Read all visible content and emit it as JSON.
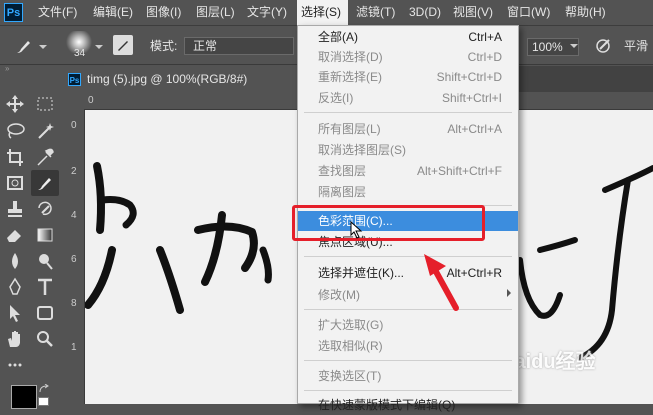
{
  "app": {
    "logo": "Ps"
  },
  "menubar": [
    {
      "label": "文件(F)",
      "active": false
    },
    {
      "label": "编辑(E)",
      "active": false
    },
    {
      "label": "图像(I)",
      "active": false
    },
    {
      "label": "图层(L)",
      "active": false
    },
    {
      "label": "文字(Y)",
      "active": false
    },
    {
      "label": "选择(S)",
      "active": true
    },
    {
      "label": "滤镜(T)",
      "active": false
    },
    {
      "label": "3D(D)",
      "active": false
    },
    {
      "label": "视图(V)",
      "active": false
    },
    {
      "label": "窗口(W)",
      "active": false
    },
    {
      "label": "帮助(H)",
      "active": false
    }
  ],
  "options": {
    "brush_size": "34",
    "mode_label": "模式:",
    "mode_value": "正常",
    "zoom_value": "100%",
    "smooth_label": "平滑"
  },
  "document": {
    "tab_title": "timg (5).jpg @ 100%(RGB/8#)",
    "ps_icon": "Ps"
  },
  "rulers": {
    "top": [
      "0"
    ],
    "left": [
      "0",
      "2",
      "4",
      "6",
      "8",
      "1"
    ]
  },
  "select_menu": {
    "items": [
      {
        "label": "全部(A)",
        "shortcut": "Ctrl+A",
        "disabled": false
      },
      {
        "label": "取消选择(D)",
        "shortcut": "Ctrl+D",
        "disabled": true
      },
      {
        "label": "重新选择(E)",
        "shortcut": "Shift+Ctrl+D",
        "disabled": true
      },
      {
        "label": "反选(I)",
        "shortcut": "Shift+Ctrl+I",
        "disabled": true
      },
      {
        "label": "所有图层(L)",
        "shortcut": "Alt+Ctrl+A",
        "disabled": true
      },
      {
        "label": "取消选择图层(S)",
        "shortcut": "",
        "disabled": true
      },
      {
        "label": "查找图层",
        "shortcut": "Alt+Shift+Ctrl+F",
        "disabled": true
      },
      {
        "label": "隔离图层",
        "shortcut": "",
        "disabled": true
      },
      {
        "label": "色彩范围(C)...",
        "shortcut": "",
        "disabled": false,
        "highlighted": true
      },
      {
        "label": "焦点区域(U)...",
        "shortcut": "",
        "disabled": false
      },
      {
        "label": "选择并遮住(K)...",
        "shortcut": "Alt+Ctrl+R",
        "disabled": false
      },
      {
        "label": "修改(M)",
        "shortcut": "",
        "disabled": true,
        "submenu": true
      },
      {
        "label": "扩大选取(G)",
        "shortcut": "",
        "disabled": true
      },
      {
        "label": "选取相似(R)",
        "shortcut": "",
        "disabled": true
      },
      {
        "label": "变换选区(T)",
        "shortcut": "",
        "disabled": true
      },
      {
        "label": "在快速蒙版模式下编辑(Q)",
        "shortcut": "",
        "disabled": false
      }
    ]
  },
  "colors": {
    "highlight": "#3c8dde",
    "annotation": "#e51f2a"
  },
  "watermark": "Baidu经验"
}
